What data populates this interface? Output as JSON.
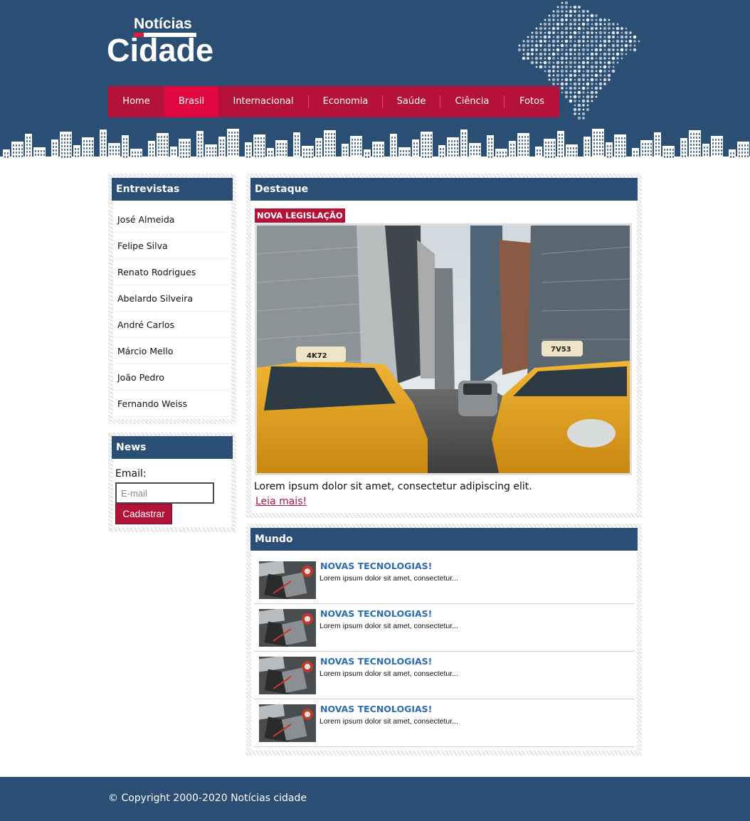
{
  "brand": {
    "small": "Notícias",
    "big": "Cidade",
    "colors": {
      "primary": "#2b4e74",
      "accent": "#b5123a",
      "accent_active": "#e0073f",
      "link": "#2a6db0"
    }
  },
  "nav": {
    "items": [
      {
        "label": "Home"
      },
      {
        "label": "Brasil",
        "active": true
      },
      {
        "label": "Internacional"
      },
      {
        "label": "Economia"
      },
      {
        "label": "Saúde"
      },
      {
        "label": "Ciência"
      },
      {
        "label": "Fotos"
      }
    ]
  },
  "sidebar": {
    "entrevistas": {
      "title": "Entrevistas",
      "items": [
        "José Almeida",
        "Felipe Silva",
        "Renato Rodrigues",
        "Abelardo Silveira",
        "André Carlos",
        "Márcio Mello",
        "João Pedro",
        "Fernando Weiss"
      ]
    },
    "news": {
      "title": "News",
      "email_label": "Email:",
      "email_placeholder": "E-mail",
      "email_value": "",
      "submit_label": "Cadastrar"
    }
  },
  "destaque": {
    "title": "Destaque",
    "tag": "NOVA LEGISLAÇÃO",
    "image": "city-street-taxis-photo",
    "summary": "Lorem ipsum dolor sit amet, consectetur adipiscing elit.",
    "more_label": "Leia mais!"
  },
  "mundo": {
    "title": "Mundo",
    "items": [
      {
        "headline": "NOVAS TECNOLOGIAS!",
        "snippet": "Lorem ipsum dolor sit amet, consectetur...",
        "image": "desk-notebook-thumbnail"
      },
      {
        "headline": "NOVAS TECNOLOGIAS!",
        "snippet": "Lorem ipsum dolor sit amet, consectetur...",
        "image": "desk-notebook-thumbnail"
      },
      {
        "headline": "NOVAS TECNOLOGIAS!",
        "snippet": "Lorem ipsum dolor sit amet, consectetur...",
        "image": "desk-notebook-thumbnail"
      },
      {
        "headline": "NOVAS TECNOLOGIAS!",
        "snippet": "Lorem ipsum dolor sit amet, consectetur...",
        "image": "desk-notebook-thumbnail"
      }
    ]
  },
  "footer": {
    "copyright": "© Copyright 2000-2020 Notícias cidade"
  }
}
